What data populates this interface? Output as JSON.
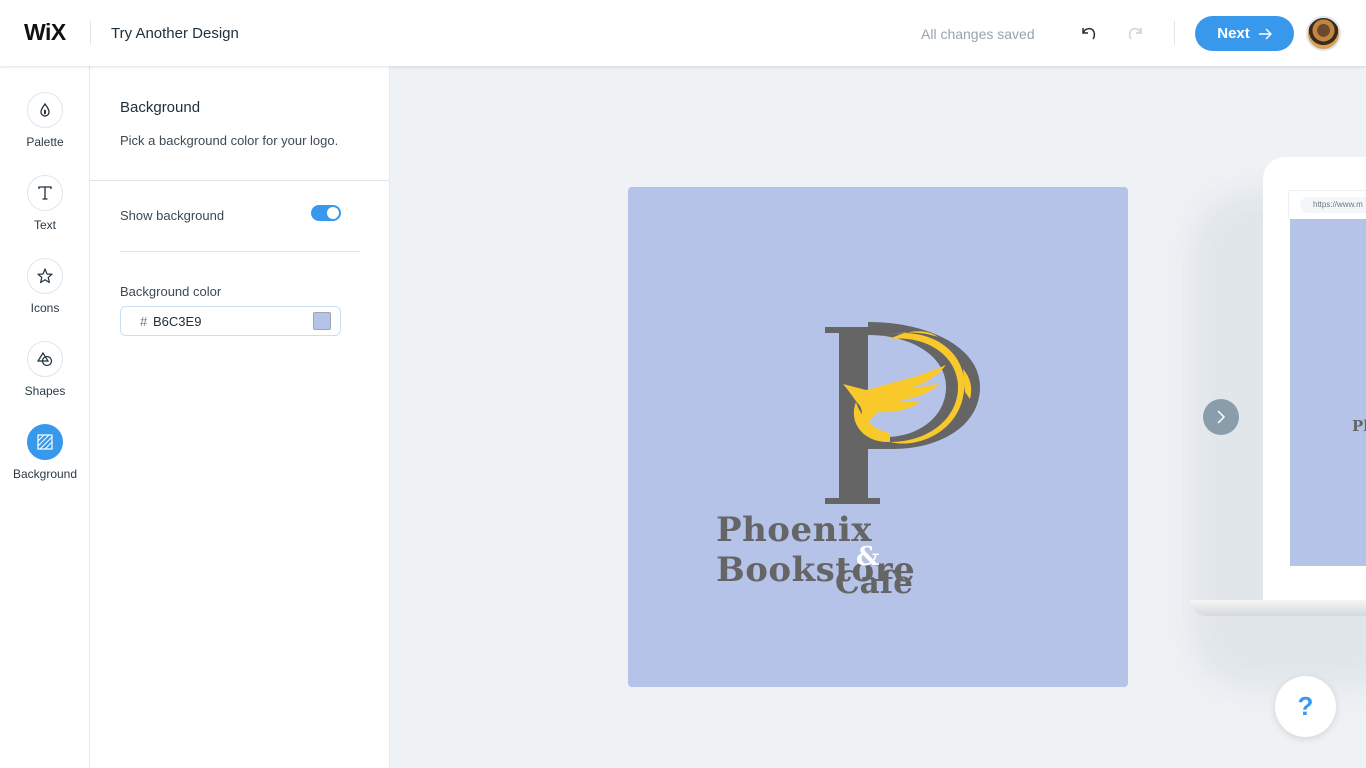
{
  "header": {
    "brand": "WiX",
    "title": "Try Another Design",
    "save_status": "All changes saved",
    "next_label": "Next",
    "undo_icon": "undo-icon",
    "redo_icon": "redo-icon",
    "avatar_icon": "user-avatar"
  },
  "nav": {
    "items": [
      {
        "label": "Palette",
        "icon": "drop-icon",
        "active": false
      },
      {
        "label": "Text",
        "icon": "text-icon",
        "active": false
      },
      {
        "label": "Icons",
        "icon": "star-icon",
        "active": false
      },
      {
        "label": "Shapes",
        "icon": "shapes-icon",
        "active": false
      },
      {
        "label": "Background",
        "icon": "background-icon",
        "active": true
      }
    ]
  },
  "panel": {
    "title": "Background",
    "subtitle": "Pick a background color for your logo.",
    "show_background_label": "Show background",
    "show_background": true,
    "background_color_label": "Background color",
    "hash": "#",
    "background_color_value": "B6C3E9"
  },
  "canvas": {
    "background_color": "#b6c3e9",
    "logo": {
      "line1": "Phoenix Bookstore",
      "ampersand": "&",
      "line2": "Cafe",
      "letter_color": "#656565",
      "phoenix_color": "#f9c92c"
    },
    "mockup": {
      "url": "https://www.m",
      "text_fragment": "Pl"
    }
  },
  "help": {
    "label": "?"
  },
  "colors": {
    "accent": "#3899ec"
  }
}
